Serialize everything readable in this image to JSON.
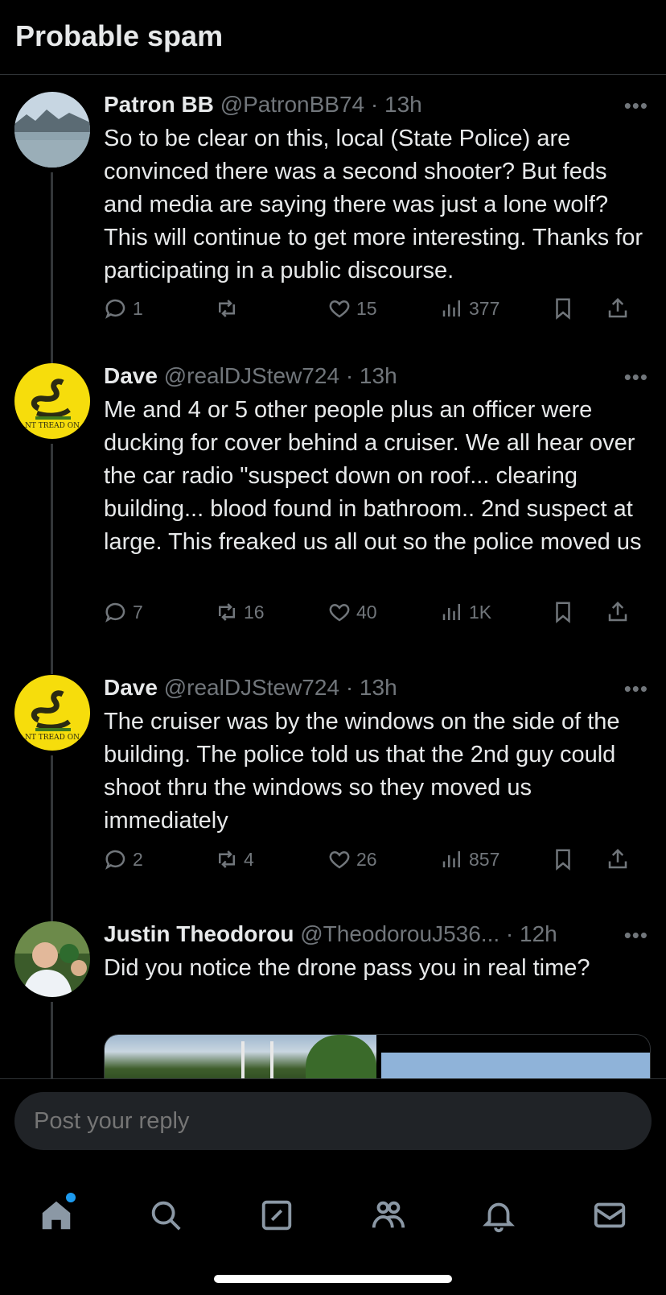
{
  "header": {
    "title": "Probable spam"
  },
  "posts": [
    {
      "name": "Patron BB",
      "handle": "@PatronBB74",
      "sep": "·",
      "time": "13h",
      "text": "So to be clear on this, local (State Police) are convinced there was a second shooter? But feds and media are saying there was just a lone wolf? This will continue to get more interesting. Thanks for participating in a public discourse.",
      "replies": "1",
      "reposts": "",
      "likes": "15",
      "views": "377"
    },
    {
      "name": "Dave",
      "handle": "@realDJStew724",
      "sep": "·",
      "time": "13h",
      "text": "Me and 4 or 5 other people plus an officer were ducking for cover behind a cruiser. We all hear over the car radio \"suspect down on roof... clearing building... blood found in bathroom.. 2nd suspect at large. This freaked us all out so the police moved us",
      "replies": "7",
      "reposts": "16",
      "likes": "40",
      "views": "1K",
      "avatar_text": "NT TREAD ON"
    },
    {
      "name": "Dave",
      "handle": "@realDJStew724",
      "sep": "·",
      "time": "13h",
      "text": "The cruiser was by the windows on the side of the building. The police told us that the 2nd guy could shoot thru the windows so they moved us immediately",
      "replies": "2",
      "reposts": "4",
      "likes": "26",
      "views": "857",
      "avatar_text": "NT TREAD ON"
    },
    {
      "name": "Justin Theodorou",
      "handle": "@TheodorouJ536...",
      "sep": "·",
      "time": "12h",
      "text": "Did you notice the drone pass you in real time?"
    }
  ],
  "more_label": "•••",
  "reply": {
    "placeholder": "Post your reply"
  },
  "colors": {
    "accent": "#1d9bf0",
    "background": "#000000",
    "muted": "#71767b",
    "text": "#e7e9ea"
  }
}
